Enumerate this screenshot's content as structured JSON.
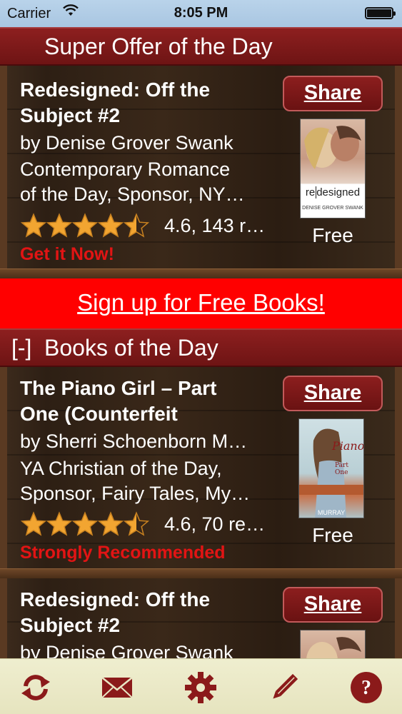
{
  "status": {
    "carrier": "Carrier",
    "time": "8:05 PM"
  },
  "offer": {
    "header": "Super Offer of the Day"
  },
  "book1": {
    "title_line1": "Redesigned: Off the",
    "title_line2": "Subject #2",
    "author": "by Denise Grover Swank",
    "genre_line1": "Contemporary Romance",
    "genre_line2": "of the Day, Sponsor, NY…",
    "rating": "4.6, 143 r…",
    "rating_value": 4.6,
    "callout": "Get it Now!",
    "share": "Share",
    "price": "Free",
    "cover_word1": "re",
    "cover_word2": "designed",
    "cover_author": "DENISE GROVER SWANK"
  },
  "signup": {
    "label": "Sign up for Free Books!"
  },
  "books_header": {
    "toggle": "[-]",
    "label": "Books of the Day"
  },
  "book2": {
    "title_line1": "The Piano Girl – Part",
    "title_line2": "One (Counterfeit",
    "author": "by Sherri Schoenborn M…",
    "genre_line1": "YA Christian of the Day,",
    "genre_line2": "Sponsor, Fairy Tales, My…",
    "rating": "4.6, 70 re…",
    "rating_value": 4.6,
    "callout": "Strongly Recommended",
    "share": "Share",
    "price": "Free",
    "cover_title": "Piano",
    "cover_sub": "Part One",
    "cover_author": "MURRAY"
  },
  "book3": {
    "title_line1": "Redesigned: Off the",
    "title_line2": "Subject #2",
    "author": "by Denise Grover Swank",
    "share": "Share"
  },
  "toolbar": {
    "icons": [
      "refresh-icon",
      "mail-icon",
      "gear-icon",
      "pencil-icon",
      "help-icon"
    ],
    "color": "#8b1a1a"
  },
  "colors": {
    "header": "#7a1818",
    "signup": "#ff0000",
    "callout": "#e21414",
    "star": "#f2a531"
  }
}
